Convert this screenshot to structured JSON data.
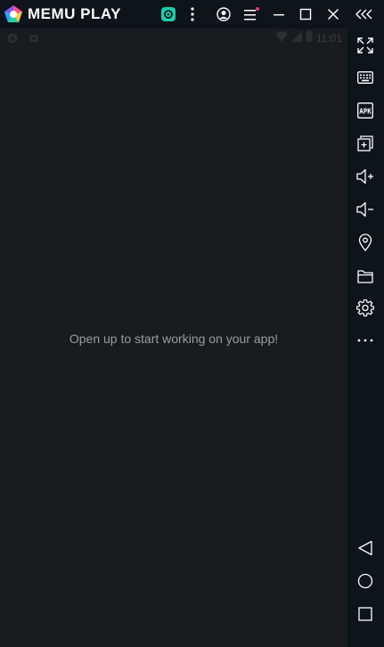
{
  "app": {
    "brand_text": "MEMU PLAY",
    "accent_color": "#1ccfae",
    "notification_dot_color": "#e23d6b"
  },
  "titlebar": {
    "icons": [
      "memu-logo-icon",
      "app-market-icon",
      "kebab-menu-icon",
      "user-account-icon",
      "hamburger-menu-icon",
      "minimize-icon",
      "maximize-icon",
      "close-icon",
      "collapse-sidebar-icon"
    ]
  },
  "statusbar": {
    "time": "11:01"
  },
  "screen": {
    "message": "Open up to start working on your app!"
  },
  "sidebar": {
    "tools": [
      "fullscreen-icon",
      "keyboard-icon",
      "apk-install-icon",
      "multi-instance-icon",
      "volume-up-icon",
      "volume-down-icon",
      "location-icon",
      "folder-icon",
      "settings-icon",
      "more-icon"
    ],
    "apk_label": "APK",
    "nav": [
      "back-icon",
      "home-icon",
      "recents-icon"
    ]
  }
}
